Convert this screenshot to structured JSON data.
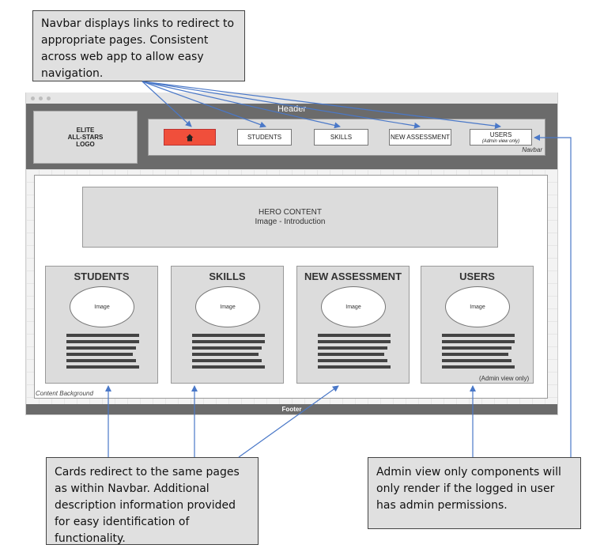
{
  "callouts": {
    "navbar_note": "Navbar displays links to redirect to appropriate pages. Consistent across web app to allow easy navigation.",
    "cards_note": "Cards redirect to the same pages as within Navbar. Additional description information provided for easy identification of functionality.",
    "admin_note": "Admin view only components will only render if the logged in user has admin permissions."
  },
  "header": {
    "title": "Header",
    "logo_text": "ELITE\nALL-STARS\nLOGO"
  },
  "navbar": {
    "label": "Navbar",
    "home_icon": "home-icon",
    "items": [
      {
        "label": "STUDENTS"
      },
      {
        "label": "SKILLS"
      },
      {
        "label": "NEW ASSESSMENT"
      },
      {
        "label": "USERS",
        "sublabel": "(Admin view only)"
      }
    ]
  },
  "hero": {
    "title": "HERO CONTENT",
    "subtitle": "Image - Introduction"
  },
  "content": {
    "background_label": "Content Background"
  },
  "cards": [
    {
      "title": "STUDENTS",
      "image_label": "Image"
    },
    {
      "title": "SKILLS",
      "image_label": "Image"
    },
    {
      "title": "NEW ASSESSMENT",
      "image_label": "Image"
    },
    {
      "title": "USERS",
      "image_label": "Image",
      "note": "(Admin view only)"
    }
  ],
  "footer": {
    "label": "Footer"
  },
  "colors": {
    "header": "#6b6b6b",
    "home_button": "#f04f3b",
    "arrow": "#4a78c8",
    "callout_bg": "#e0e0e0"
  }
}
